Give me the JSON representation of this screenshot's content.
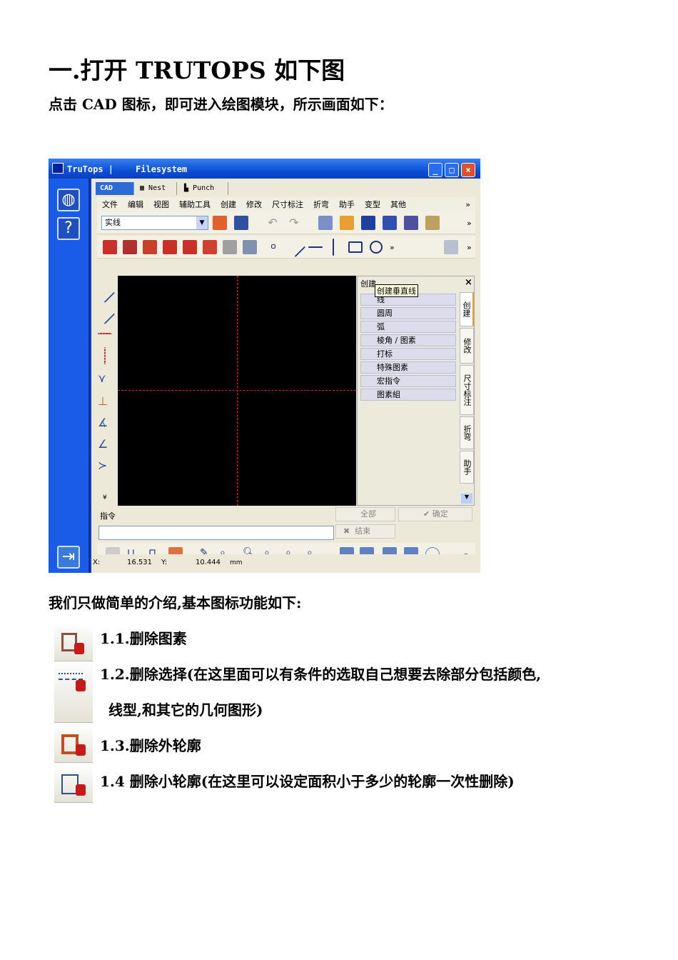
{
  "heading": "一.打开 TRUTOPS 如下图",
  "intro": "点击 CAD 图标，即可进入绘图模块，所示画面如下：",
  "window": {
    "title_app": "TruTops |",
    "title_section": "Filesystem",
    "tabs": [
      "CAD",
      "Nest",
      "Punch"
    ],
    "menu": [
      "文件",
      "编辑",
      "视图",
      "辅助工具",
      "创建",
      "修改",
      "尺寸标注",
      "折弯",
      "助手",
      "变型",
      "其他",
      "»"
    ],
    "linetype_value": "实线",
    "more": "»",
    "panel": {
      "title": "创建",
      "close": "×",
      "tooltip": "创建垂直线",
      "rows": [
        "线",
        "圆周",
        "弧",
        "棱角 / 图素",
        "打标",
        "特殊图素",
        "宏指令",
        "图素組"
      ],
      "vtabs": [
        "创建",
        "修改",
        "尺寸标注",
        "折弯",
        "助手"
      ]
    },
    "command": {
      "label": "指令",
      "input_value": "",
      "all": "全部",
      "ok": "确定",
      "end": "结束"
    },
    "status": {
      "x_label": "X:",
      "x_value": "16.531",
      "y_label": "Y:",
      "y_value": "10.444",
      "unit": "mm"
    }
  },
  "summary": "我们只做简单的介绍,基本图标功能如下:",
  "items": [
    {
      "text": "1.1.删除图素"
    },
    {
      "text": "1.2.删除选择(在这里面可以有条件的选取自己想要去除部分包括颜色,",
      "cont": "线型,和其它的几何图形)"
    },
    {
      "text": "1.3.删除外轮廓"
    },
    {
      "text": "1.4 删除小轮廓(在这里可以设定面积小于多少的轮廓一次性删除)"
    }
  ]
}
